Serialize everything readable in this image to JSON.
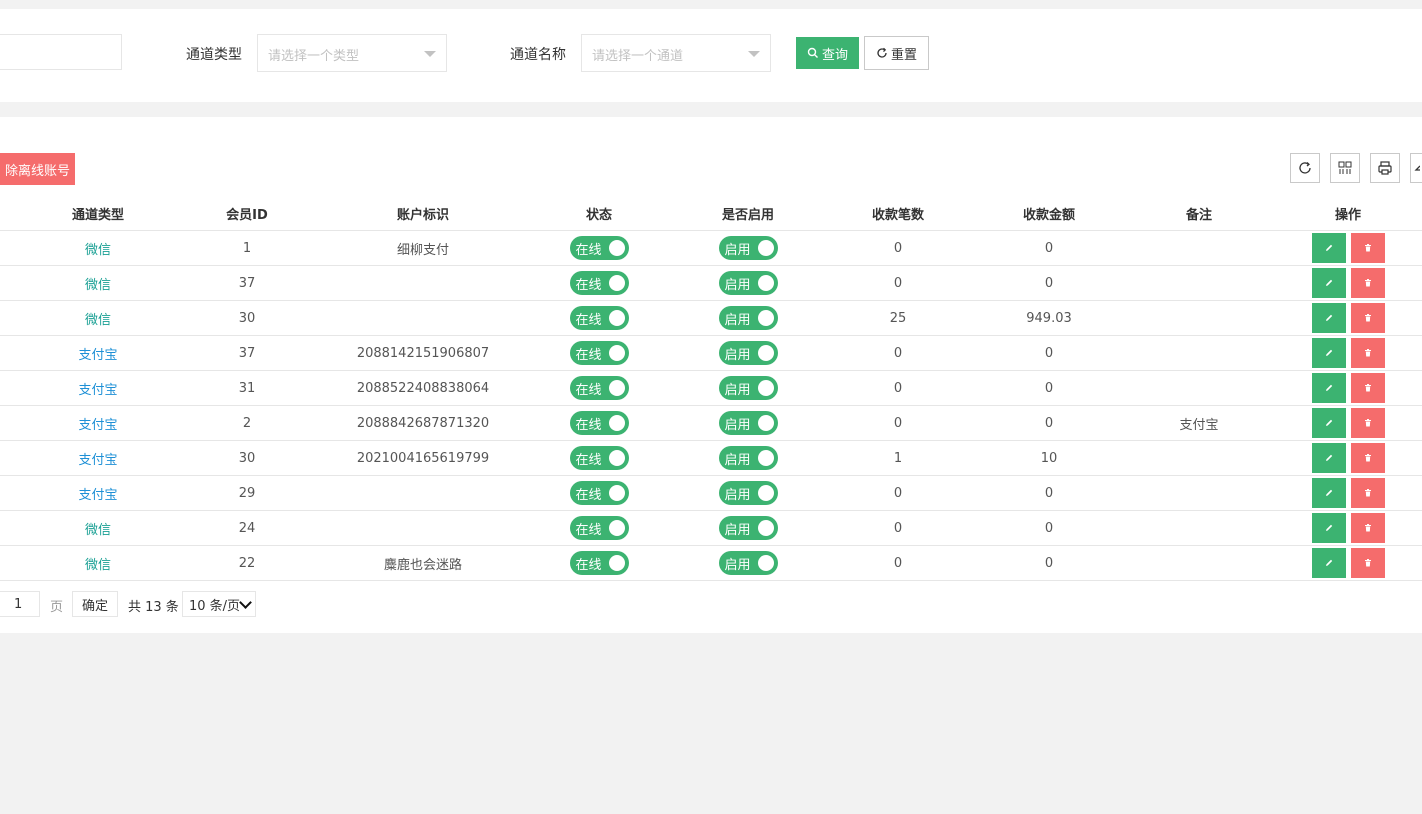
{
  "filters": {
    "channel_type_label": "通道类型",
    "channel_type_placeholder": "请选择一个类型",
    "channel_name_label": "通道名称",
    "channel_name_placeholder": "请选择一个通道",
    "query_label": "查询",
    "reset_label": "重置"
  },
  "toolbar": {
    "delete_offline_label": "除离线账号"
  },
  "table": {
    "headers": {
      "channel_type": "通道类型",
      "member_id": "会员ID",
      "account_tag": "账户标识",
      "status": "状态",
      "enabled": "是否启用",
      "count": "收款笔数",
      "amount": "收款金额",
      "remark": "备注",
      "actions": "操作"
    },
    "rows": [
      {
        "channel_type": "微信",
        "member_id": "1",
        "account_tag": "细柳支付",
        "status": "在线",
        "enabled": "启用",
        "count": "0",
        "amount": "0",
        "remark": ""
      },
      {
        "channel_type": "微信",
        "member_id": "37",
        "account_tag": "",
        "status": "在线",
        "enabled": "启用",
        "count": "0",
        "amount": "0",
        "remark": ""
      },
      {
        "channel_type": "微信",
        "member_id": "30",
        "account_tag": "",
        "status": "在线",
        "enabled": "启用",
        "count": "25",
        "amount": "949.03",
        "remark": ""
      },
      {
        "channel_type": "支付宝",
        "member_id": "37",
        "account_tag": "2088142151906807",
        "status": "在线",
        "enabled": "启用",
        "count": "0",
        "amount": "0",
        "remark": ""
      },
      {
        "channel_type": "支付宝",
        "member_id": "31",
        "account_tag": "2088522408838064",
        "status": "在线",
        "enabled": "启用",
        "count": "0",
        "amount": "0",
        "remark": ""
      },
      {
        "channel_type": "支付宝",
        "member_id": "2",
        "account_tag": "2088842687871320",
        "status": "在线",
        "enabled": "启用",
        "count": "0",
        "amount": "0",
        "remark": "支付宝"
      },
      {
        "channel_type": "支付宝",
        "member_id": "30",
        "account_tag": "2021004165619799",
        "status": "在线",
        "enabled": "启用",
        "count": "1",
        "amount": "10",
        "remark": ""
      },
      {
        "channel_type": "支付宝",
        "member_id": "29",
        "account_tag": "",
        "status": "在线",
        "enabled": "启用",
        "count": "0",
        "amount": "0",
        "remark": ""
      },
      {
        "channel_type": "微信",
        "member_id": "24",
        "account_tag": "",
        "status": "在线",
        "enabled": "启用",
        "count": "0",
        "amount": "0",
        "remark": ""
      },
      {
        "channel_type": "微信",
        "member_id": "22",
        "account_tag": "麋鹿也会迷路",
        "status": "在线",
        "enabled": "启用",
        "count": "0",
        "amount": "0",
        "remark": ""
      }
    ]
  },
  "pagination": {
    "current_page": "1",
    "page_unit": "页",
    "confirm_label": "确定",
    "total_label": "共 13 条",
    "page_size_label": "10 条/页"
  },
  "colors": {
    "primary_green": "#3cb371",
    "danger_red": "#f56c6c",
    "wechat_text": "#1aa094",
    "alipay_text": "#1e90d6"
  },
  "icons": {
    "query": "search-icon",
    "reset": "refresh-icon",
    "tools": [
      "refresh-icon",
      "columns-icon",
      "print-icon",
      "export-icon"
    ],
    "edit": "pencil-icon",
    "delete": "trash-icon"
  }
}
